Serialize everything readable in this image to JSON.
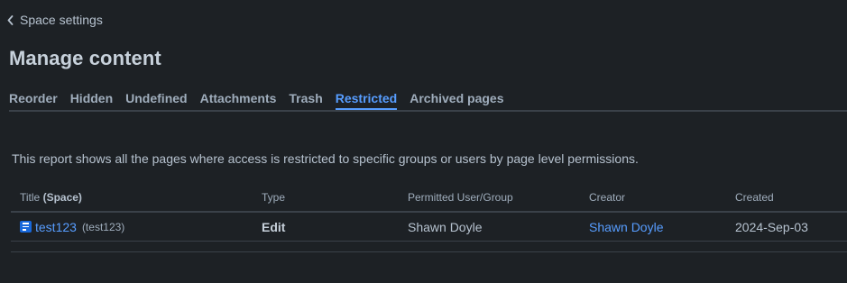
{
  "header": {
    "back_label": "Space settings",
    "title": "Manage content"
  },
  "tabs": [
    {
      "label": "Reorder",
      "active": false
    },
    {
      "label": "Hidden",
      "active": false
    },
    {
      "label": "Undefined",
      "active": false
    },
    {
      "label": "Attachments",
      "active": false
    },
    {
      "label": "Trash",
      "active": false
    },
    {
      "label": "Restricted",
      "active": true
    },
    {
      "label": "Archived pages",
      "active": false
    }
  ],
  "description": "This report shows all the pages where access is restricted to specific groups or users by page level permissions.",
  "table": {
    "headers": {
      "title": "Title",
      "space": "(Space)",
      "type": "Type",
      "permitted": "Permitted User/Group",
      "creator": "Creator",
      "created": "Created"
    },
    "rows": [
      {
        "title": "test123",
        "space": "(test123)",
        "type": "Edit",
        "permitted": "Shawn Doyle",
        "creator": "Shawn Doyle",
        "created": "2024-Sep-03"
      }
    ]
  },
  "colors": {
    "background": "#1d2125",
    "accent": "#579dff",
    "text": "#b6c2cf",
    "page_icon": "#1868db"
  },
  "icons": {
    "back": "chevron-left-icon",
    "page": "page-icon"
  }
}
